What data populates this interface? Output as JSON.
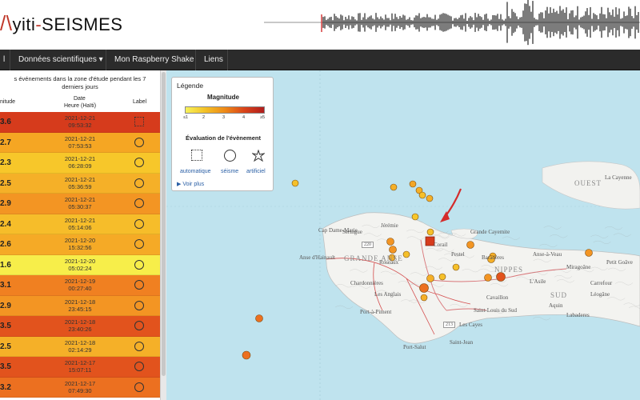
{
  "header": {
    "logo_prefix": "yiti",
    "logo_suffix": "SEISMES",
    "logo_dash": "-"
  },
  "nav": {
    "items": [
      "Données scientifiques ▾",
      "Mon Raspberry Shake",
      "Liens"
    ]
  },
  "sidebar": {
    "title": "s événements dans la zone d'étude pendant les 7 derniers jours",
    "col_mag": "nitude",
    "col_date_line1": "Date",
    "col_date_line2": "Heure (Haïti)",
    "col_label": "Label",
    "rows": [
      {
        "mag": "3.6",
        "date": "2021-12-21",
        "time": "09:53:32",
        "color": "#d63b1c",
        "label": "square"
      },
      {
        "mag": "2.7",
        "date": "2021-12-21",
        "time": "07:53:53",
        "color": "#f5a623",
        "label": "circle"
      },
      {
        "mag": "2.3",
        "date": "2021-12-21",
        "time": "06:28:09",
        "color": "#f7c72a",
        "label": "circle"
      },
      {
        "mag": "2.5",
        "date": "2021-12-21",
        "time": "05:36:59",
        "color": "#f5b028",
        "label": "circle"
      },
      {
        "mag": "2.9",
        "date": "2021-12-21",
        "time": "05:30:37",
        "color": "#f39523",
        "label": "circle"
      },
      {
        "mag": "2.4",
        "date": "2021-12-21",
        "time": "05:14:06",
        "color": "#f6bd2a",
        "label": "circle"
      },
      {
        "mag": "2.6",
        "date": "2021-12-20",
        "time": "15:32:56",
        "color": "#f5aa26",
        "label": "circle"
      },
      {
        "mag": "1.6",
        "date": "2021-12-20",
        "time": "05:02:24",
        "color": "#f7ee4a",
        "label": "circle"
      },
      {
        "mag": "3.1",
        "date": "2021-12-19",
        "time": "00:27:40",
        "color": "#f08021",
        "label": "circle"
      },
      {
        "mag": "2.9",
        "date": "2021-12-18",
        "time": "23:45:15",
        "color": "#f39523",
        "label": "circle"
      },
      {
        "mag": "3.5",
        "date": "2021-12-18",
        "time": "23:40:26",
        "color": "#e2531d",
        "label": "circle"
      },
      {
        "mag": "2.5",
        "date": "2021-12-18",
        "time": "02:14:29",
        "color": "#f5b028",
        "label": "circle"
      },
      {
        "mag": "3.5",
        "date": "2021-12-17",
        "time": "15:07:11",
        "color": "#e2531d",
        "label": "circle"
      },
      {
        "mag": "3.2",
        "date": "2021-12-17",
        "time": "07:49:30",
        "color": "#ec7020",
        "label": "circle"
      }
    ]
  },
  "legend": {
    "title": "Légende",
    "magnitude": "Magnitude",
    "ticks": [
      "≤1",
      "2",
      "3",
      "4",
      "≥5"
    ],
    "evaluation": "Évaluation de l'évènement",
    "types": [
      "automatique",
      "séisme",
      "artificiel"
    ],
    "more": "▶ Voir plus"
  },
  "map": {
    "places": [
      "Cap Dame-Marie",
      "Jérémie",
      "Seringue",
      "Corail",
      "Grande Cayemite",
      "Anse-à-Veau",
      "Baradères",
      "Pestel",
      "Miragoâne",
      "Petit Goâve",
      "Cavaillon",
      "L'Asile",
      "Aquin",
      "Saint-Louis du Sud",
      "Les Cayes",
      "Les Anglais",
      "Port-à-Piment",
      "Port-Salut",
      "Saint-Jean",
      "Anse d'Hainault",
      "Roseaux",
      "Carrefour",
      "La Cayenne",
      "Léogâne",
      "Labaderes",
      "Chardonnières"
    ],
    "regions": [
      "GRANDE ANSE",
      "NIPPES",
      "SUD",
      "OUEST"
    ],
    "roads": [
      "220",
      "213"
    ]
  }
}
